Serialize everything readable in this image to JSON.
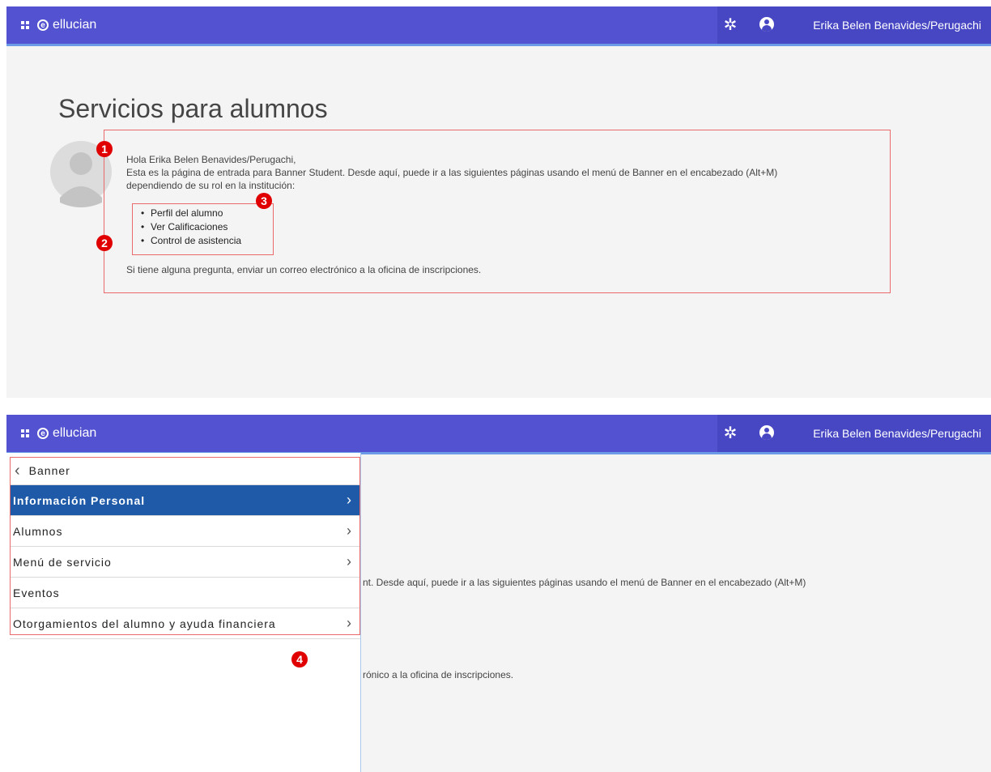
{
  "topbar": {
    "logo_text": "ellucian",
    "logo_mark": "e",
    "user_name": "Erika Belen Benavides/Perugachi",
    "icons": [
      "apps-grid-icon",
      "ellucian-logo-icon",
      "gear-icon",
      "user-icon"
    ]
  },
  "page": {
    "title": "Servicios para alumnos",
    "welcome": {
      "greeting": "Hola Erika Belen Benavides/Perugachi,",
      "line1": "Esta es la página de entrada para Banner Student. Desde aquí, puede ir a las siguientes páginas usando el menú de Banner en el encabezado (Alt+M)",
      "line2": "dependiendo de su rol en la institución:",
      "links": [
        "Perfil del alumno",
        "Ver Calificaciones",
        "Control de asistencia"
      ],
      "footer": "Si tiene alguna pregunta, enviar un correo electrónico a la oficina de inscripciones."
    }
  },
  "annotations": [
    "1",
    "2",
    "3",
    "4"
  ],
  "panel2": {
    "bg_line1_tail": "nt. Desde aquí, puede ir a las siguientes páginas usando el menú de Banner en el encabezado (Alt+M)",
    "bg_footer_tail": "rónico a la oficina de inscripciones."
  },
  "menu": {
    "back_label": "Banner",
    "items": [
      {
        "label": "Información Personal",
        "has_submenu": true,
        "active": true
      },
      {
        "label": "Alumnos",
        "has_submenu": true,
        "active": false
      },
      {
        "label": "Menú de servicio",
        "has_submenu": true,
        "active": false
      },
      {
        "label": "Eventos",
        "has_submenu": false,
        "active": false
      },
      {
        "label": "Otorgamientos del alumno y ayuda financiera",
        "has_submenu": true,
        "active": false
      }
    ]
  },
  "colors": {
    "header": "#5353d1",
    "header_accent": "#6b9be6",
    "menu_active": "#1e5aa8",
    "annotation_red": "#e00000",
    "highlight_border": "#e86a6a"
  }
}
